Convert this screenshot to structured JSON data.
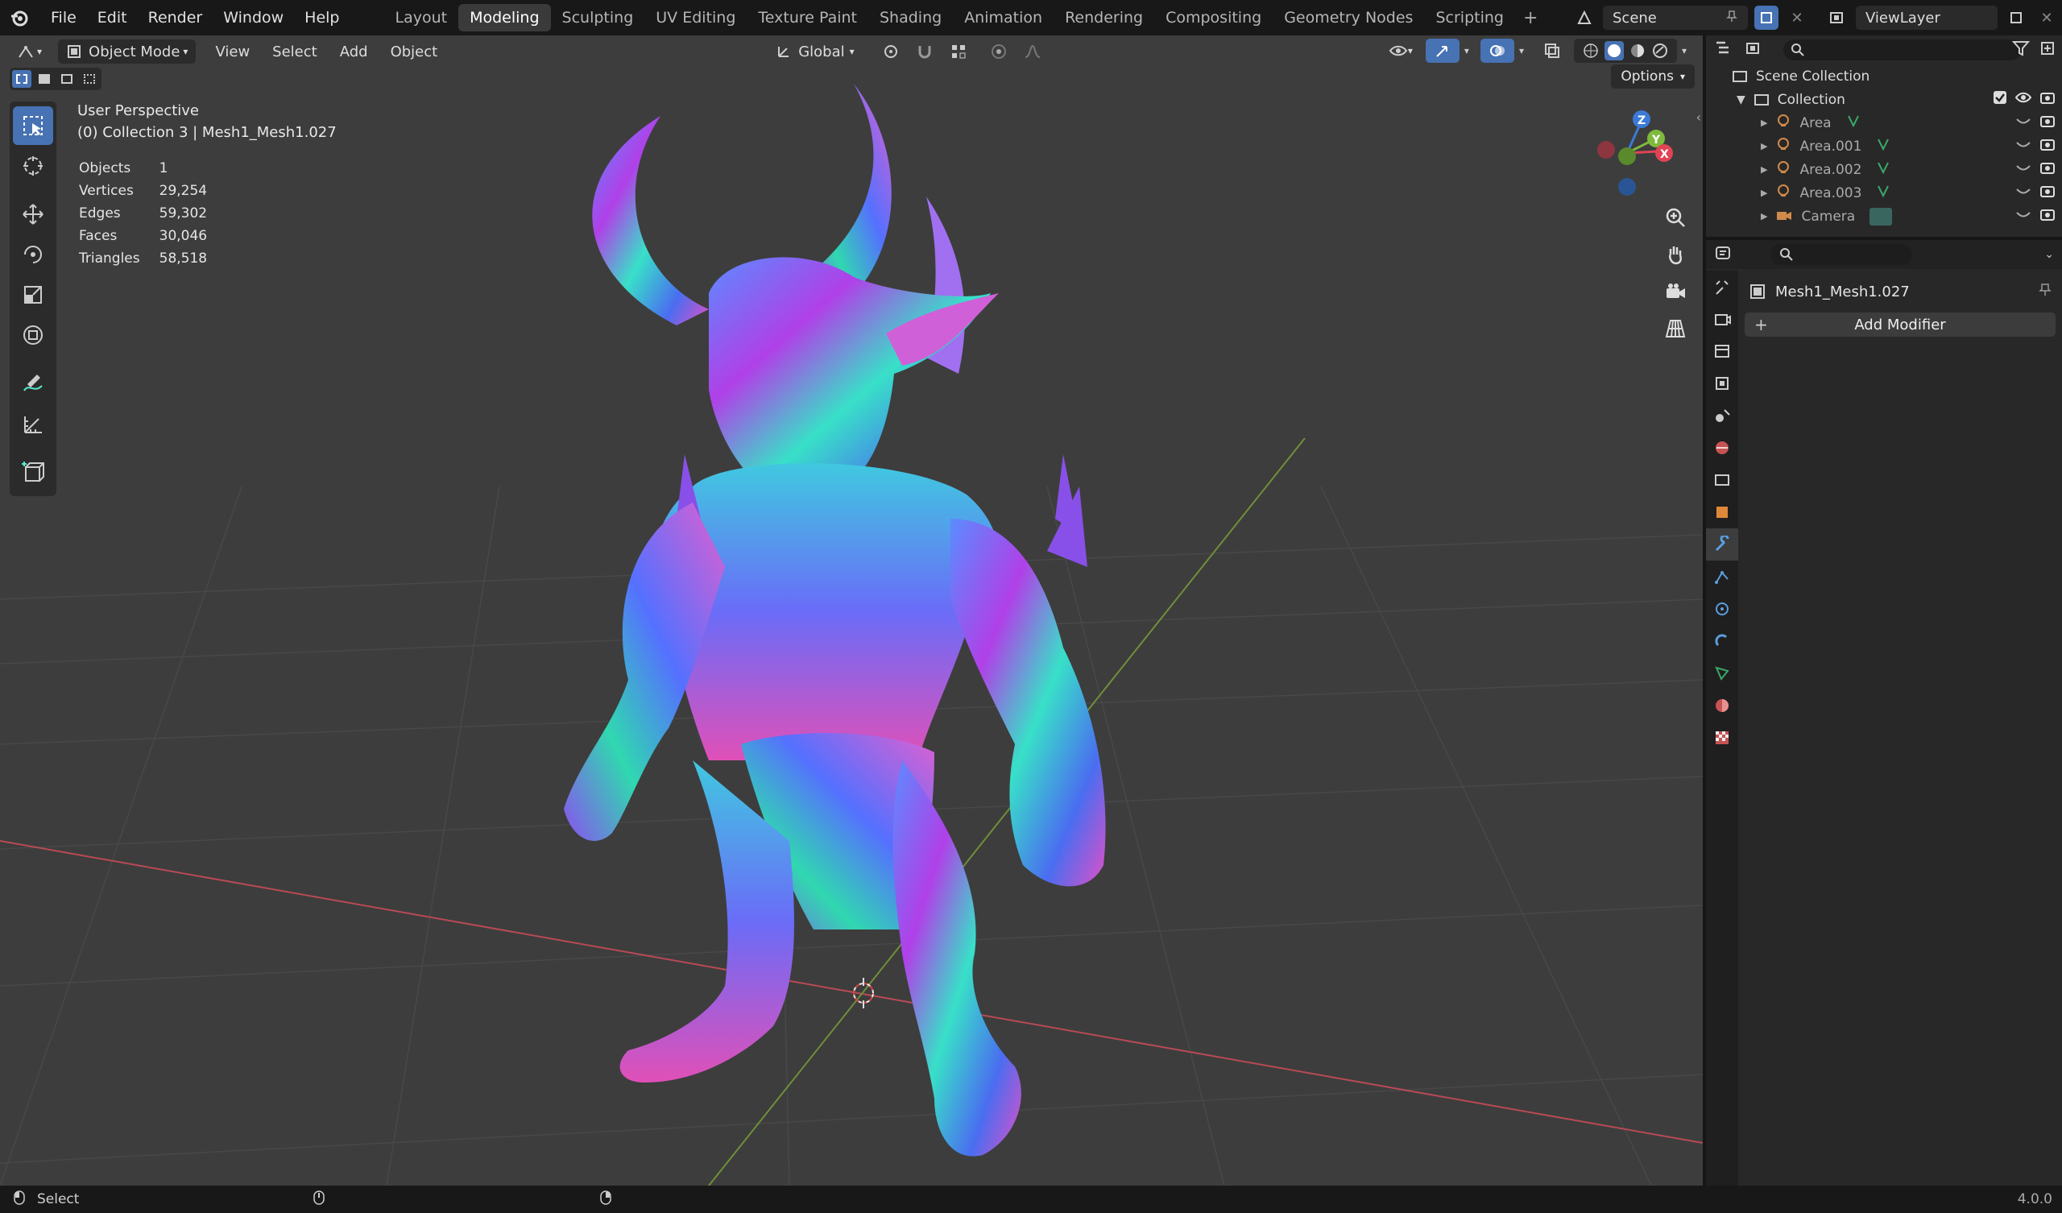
{
  "menu": {
    "items": [
      "File",
      "Edit",
      "Render",
      "Window",
      "Help"
    ]
  },
  "workspaces": {
    "tabs": [
      "Layout",
      "Modeling",
      "Sculpting",
      "UV Editing",
      "Texture Paint",
      "Shading",
      "Animation",
      "Rendering",
      "Compositing",
      "Geometry Nodes",
      "Scripting"
    ],
    "active": "Modeling",
    "add": "+"
  },
  "scene": {
    "name": "Scene",
    "view_layer": "ViewLayer"
  },
  "viewport": {
    "mode": "Object Mode",
    "menus": [
      "View",
      "Select",
      "Add",
      "Object"
    ],
    "transform": "Global",
    "options_label": "Options",
    "view_name": "User Perspective",
    "collection_info": "(0) Collection 3 | Mesh1_Mesh1.027",
    "stats": [
      {
        "label": "Objects",
        "value": "1"
      },
      {
        "label": "Vertices",
        "value": "29,254"
      },
      {
        "label": "Edges",
        "value": "59,302"
      },
      {
        "label": "Faces",
        "value": "30,046"
      },
      {
        "label": "Triangles",
        "value": "58,518"
      }
    ],
    "gizmo": {
      "z": "Z",
      "y": "Y",
      "x": "X"
    }
  },
  "outliner": {
    "root": "Scene Collection",
    "collection": "Collection",
    "items": [
      "Area",
      "Area.001",
      "Area.002",
      "Area.003",
      "Camera"
    ]
  },
  "properties": {
    "object_name": "Mesh1_Mesh1.027",
    "add_modifier": "Add Modifier"
  },
  "status": {
    "left": "Select",
    "version": "4.0.0"
  },
  "colors": {
    "accent": "#4772b3",
    "x_axis": "#e04454",
    "y_axis": "#7fba3c",
    "z_axis": "#3b7ad8"
  }
}
